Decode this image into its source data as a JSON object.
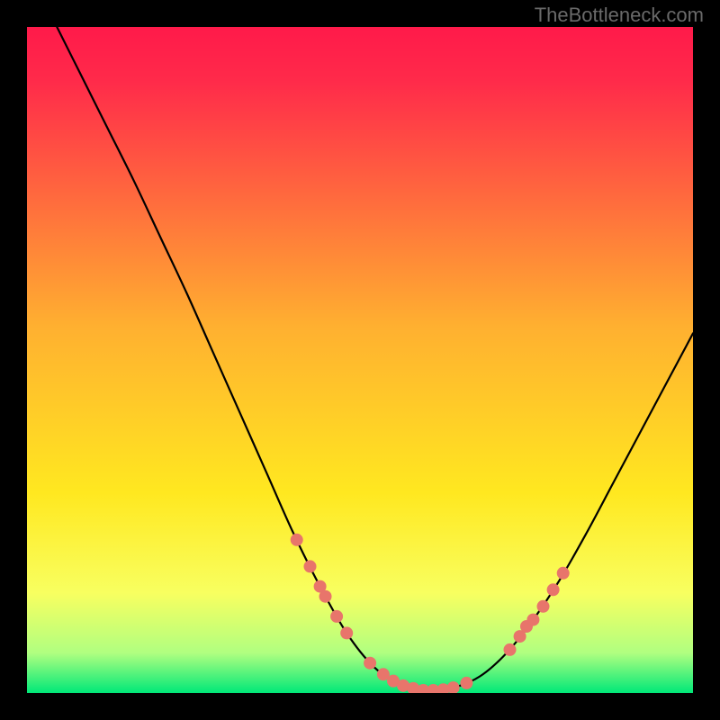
{
  "watermark": "TheBottleneck.com",
  "chart_data": {
    "type": "line",
    "title": "",
    "xlabel": "",
    "ylabel": "",
    "xlim": [
      0,
      100
    ],
    "ylim": [
      0,
      100
    ],
    "background_gradient": {
      "stops": [
        {
          "offset": 0.0,
          "color": "#ff1a4a"
        },
        {
          "offset": 0.08,
          "color": "#ff2a4a"
        },
        {
          "offset": 0.45,
          "color": "#ffb030"
        },
        {
          "offset": 0.7,
          "color": "#ffe820"
        },
        {
          "offset": 0.85,
          "color": "#f8ff60"
        },
        {
          "offset": 0.94,
          "color": "#b0ff80"
        },
        {
          "offset": 1.0,
          "color": "#00e878"
        }
      ]
    },
    "series": [
      {
        "name": "bottleneck-curve",
        "color": "#000000",
        "width": 2.2,
        "points": [
          {
            "x": 4.5,
            "y": 100.0
          },
          {
            "x": 8.0,
            "y": 93.0
          },
          {
            "x": 12.0,
            "y": 85.0
          },
          {
            "x": 16.0,
            "y": 77.0
          },
          {
            "x": 20.0,
            "y": 68.5
          },
          {
            "x": 24.0,
            "y": 60.0
          },
          {
            "x": 28.0,
            "y": 51.0
          },
          {
            "x": 32.0,
            "y": 42.0
          },
          {
            "x": 36.0,
            "y": 33.0
          },
          {
            "x": 40.0,
            "y": 24.0
          },
          {
            "x": 44.0,
            "y": 16.0
          },
          {
            "x": 48.0,
            "y": 9.0
          },
          {
            "x": 52.0,
            "y": 4.0
          },
          {
            "x": 56.0,
            "y": 1.2
          },
          {
            "x": 60.0,
            "y": 0.4
          },
          {
            "x": 64.0,
            "y": 0.8
          },
          {
            "x": 68.0,
            "y": 2.5
          },
          {
            "x": 72.0,
            "y": 6.0
          },
          {
            "x": 76.0,
            "y": 11.0
          },
          {
            "x": 80.0,
            "y": 17.0
          },
          {
            "x": 84.0,
            "y": 24.0
          },
          {
            "x": 88.0,
            "y": 31.5
          },
          {
            "x": 92.0,
            "y": 39.0
          },
          {
            "x": 96.0,
            "y": 46.5
          },
          {
            "x": 100.0,
            "y": 54.0
          }
        ]
      }
    ],
    "markers": {
      "name": "data-points",
      "color": "#e8756b",
      "radius": 7,
      "points": [
        {
          "x": 40.5,
          "y": 23.0
        },
        {
          "x": 42.5,
          "y": 19.0
        },
        {
          "x": 44.0,
          "y": 16.0
        },
        {
          "x": 44.8,
          "y": 14.5
        },
        {
          "x": 46.5,
          "y": 11.5
        },
        {
          "x": 48.0,
          "y": 9.0
        },
        {
          "x": 51.5,
          "y": 4.5
        },
        {
          "x": 53.5,
          "y": 2.8
        },
        {
          "x": 55.0,
          "y": 1.8
        },
        {
          "x": 56.5,
          "y": 1.1
        },
        {
          "x": 58.0,
          "y": 0.7
        },
        {
          "x": 59.5,
          "y": 0.4
        },
        {
          "x": 61.0,
          "y": 0.4
        },
        {
          "x": 62.5,
          "y": 0.5
        },
        {
          "x": 64.0,
          "y": 0.8
        },
        {
          "x": 66.0,
          "y": 1.5
        },
        {
          "x": 72.5,
          "y": 6.5
        },
        {
          "x": 74.0,
          "y": 8.5
        },
        {
          "x": 75.0,
          "y": 10.0
        },
        {
          "x": 76.0,
          "y": 11.0
        },
        {
          "x": 77.5,
          "y": 13.0
        },
        {
          "x": 79.0,
          "y": 15.5
        },
        {
          "x": 80.5,
          "y": 18.0
        }
      ]
    }
  }
}
